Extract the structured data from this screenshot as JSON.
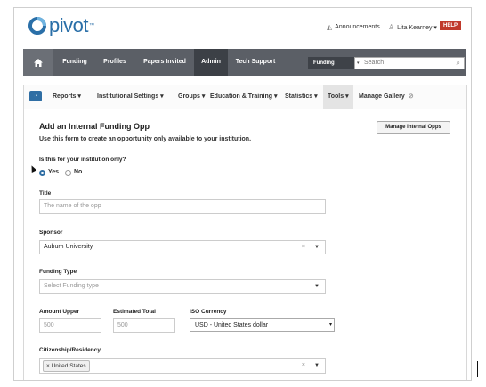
{
  "brand": {
    "name": "pivot",
    "tm": "™"
  },
  "utility": {
    "announcements": "Announcements",
    "user": "Lita Kearney ▾",
    "help": "HELP"
  },
  "mainnav": {
    "home_icon": "home-icon",
    "items": [
      "Funding",
      "Profiles",
      "Papers Invited",
      "Admin",
      "Tech Support"
    ],
    "search_scope": "Funding",
    "search_placeholder": "Search"
  },
  "subnav": {
    "dashboard_icon": "dashboard-icon",
    "items": [
      "Reports ▾",
      "Institutional Settings ▾",
      "Groups ▾",
      "Education & Training ▾",
      "Statistics ▾",
      "Tools ▾",
      "Manage Gallery"
    ]
  },
  "form": {
    "title": "Add an Internal Funding Opp",
    "description": "Use this form to create an opportunity only available to your institution.",
    "manage_button": "Manage Internal Opps",
    "institution_only": {
      "label": "Is this for your institution only?",
      "options": [
        "Yes",
        "No"
      ],
      "selected": "Yes"
    },
    "title_field": {
      "label": "Title",
      "placeholder": "The name of the opp"
    },
    "sponsor": {
      "label": "Sponsor",
      "value": "Auburn University",
      "clear": "×",
      "caret": "▼"
    },
    "funding_type": {
      "label": "Funding Type",
      "placeholder": "Select Funding type",
      "caret": "▼"
    },
    "amount_upper": {
      "label": "Amount Upper",
      "placeholder": "500"
    },
    "estimated_total": {
      "label": "Estimated Total",
      "placeholder": "500"
    },
    "iso_currency": {
      "label": "ISO Currency",
      "value": "USD - United States dollar",
      "caret": "▾"
    },
    "citizenship": {
      "label": "Citizenship/Residency",
      "tag": "× United States",
      "clear": "×",
      "caret": "▼"
    }
  }
}
